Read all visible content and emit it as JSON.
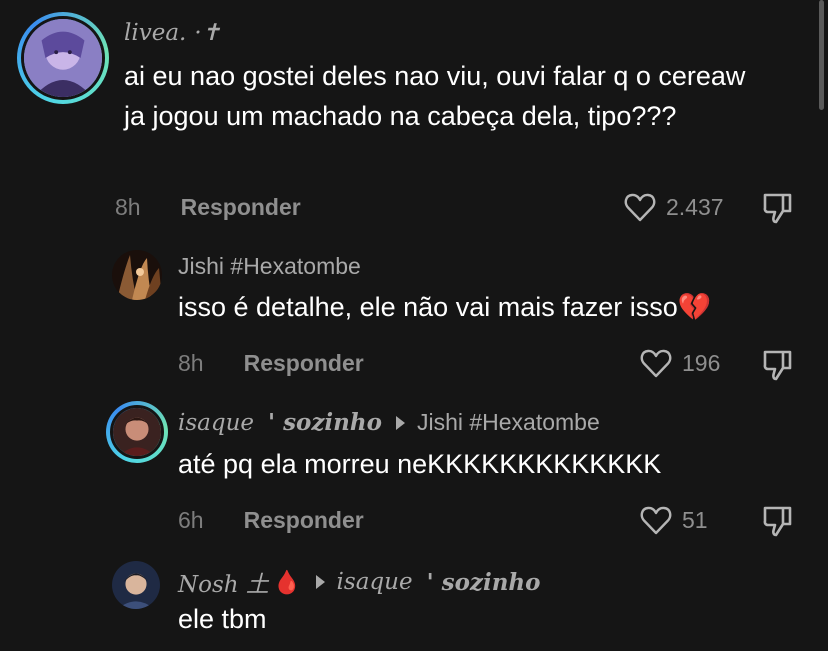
{
  "comments": [
    {
      "username": "livea.",
      "username_suffix": "·✝",
      "text": "ai eu nao gostei deles nao viu, ouvi falar q o cereaw ja jogou um machado na cabeça dela, tipo???",
      "time": "8h",
      "reply_label": "Responder",
      "likes": "2.437"
    },
    {
      "username": "Jishi #Hexatombe",
      "text": "isso é detalhe, ele não vai mais fazer isso💔",
      "time": "8h",
      "reply_label": "Responder",
      "likes": "196"
    },
    {
      "username_a": "isaque",
      "username_b": "' sozinho",
      "reply_to": "Jishi #Hexatombe",
      "text": "até pq ela morreu neKKKKKKKKKKKKK",
      "time": "6h",
      "reply_label": "Responder",
      "likes": "51"
    },
    {
      "username": "Nosh 土",
      "username_emoji": "🩸",
      "reply_to_a": "isaque",
      "reply_to_b": "' sozinho",
      "text": "ele tbm"
    }
  ],
  "colors": {
    "background": "#151515",
    "text": "#ffffff",
    "muted": "#a9a9a9",
    "ring": "#4fd6e6"
  },
  "icons": [
    "heart-icon",
    "dislike-icon",
    "reply-arrow-icon"
  ]
}
